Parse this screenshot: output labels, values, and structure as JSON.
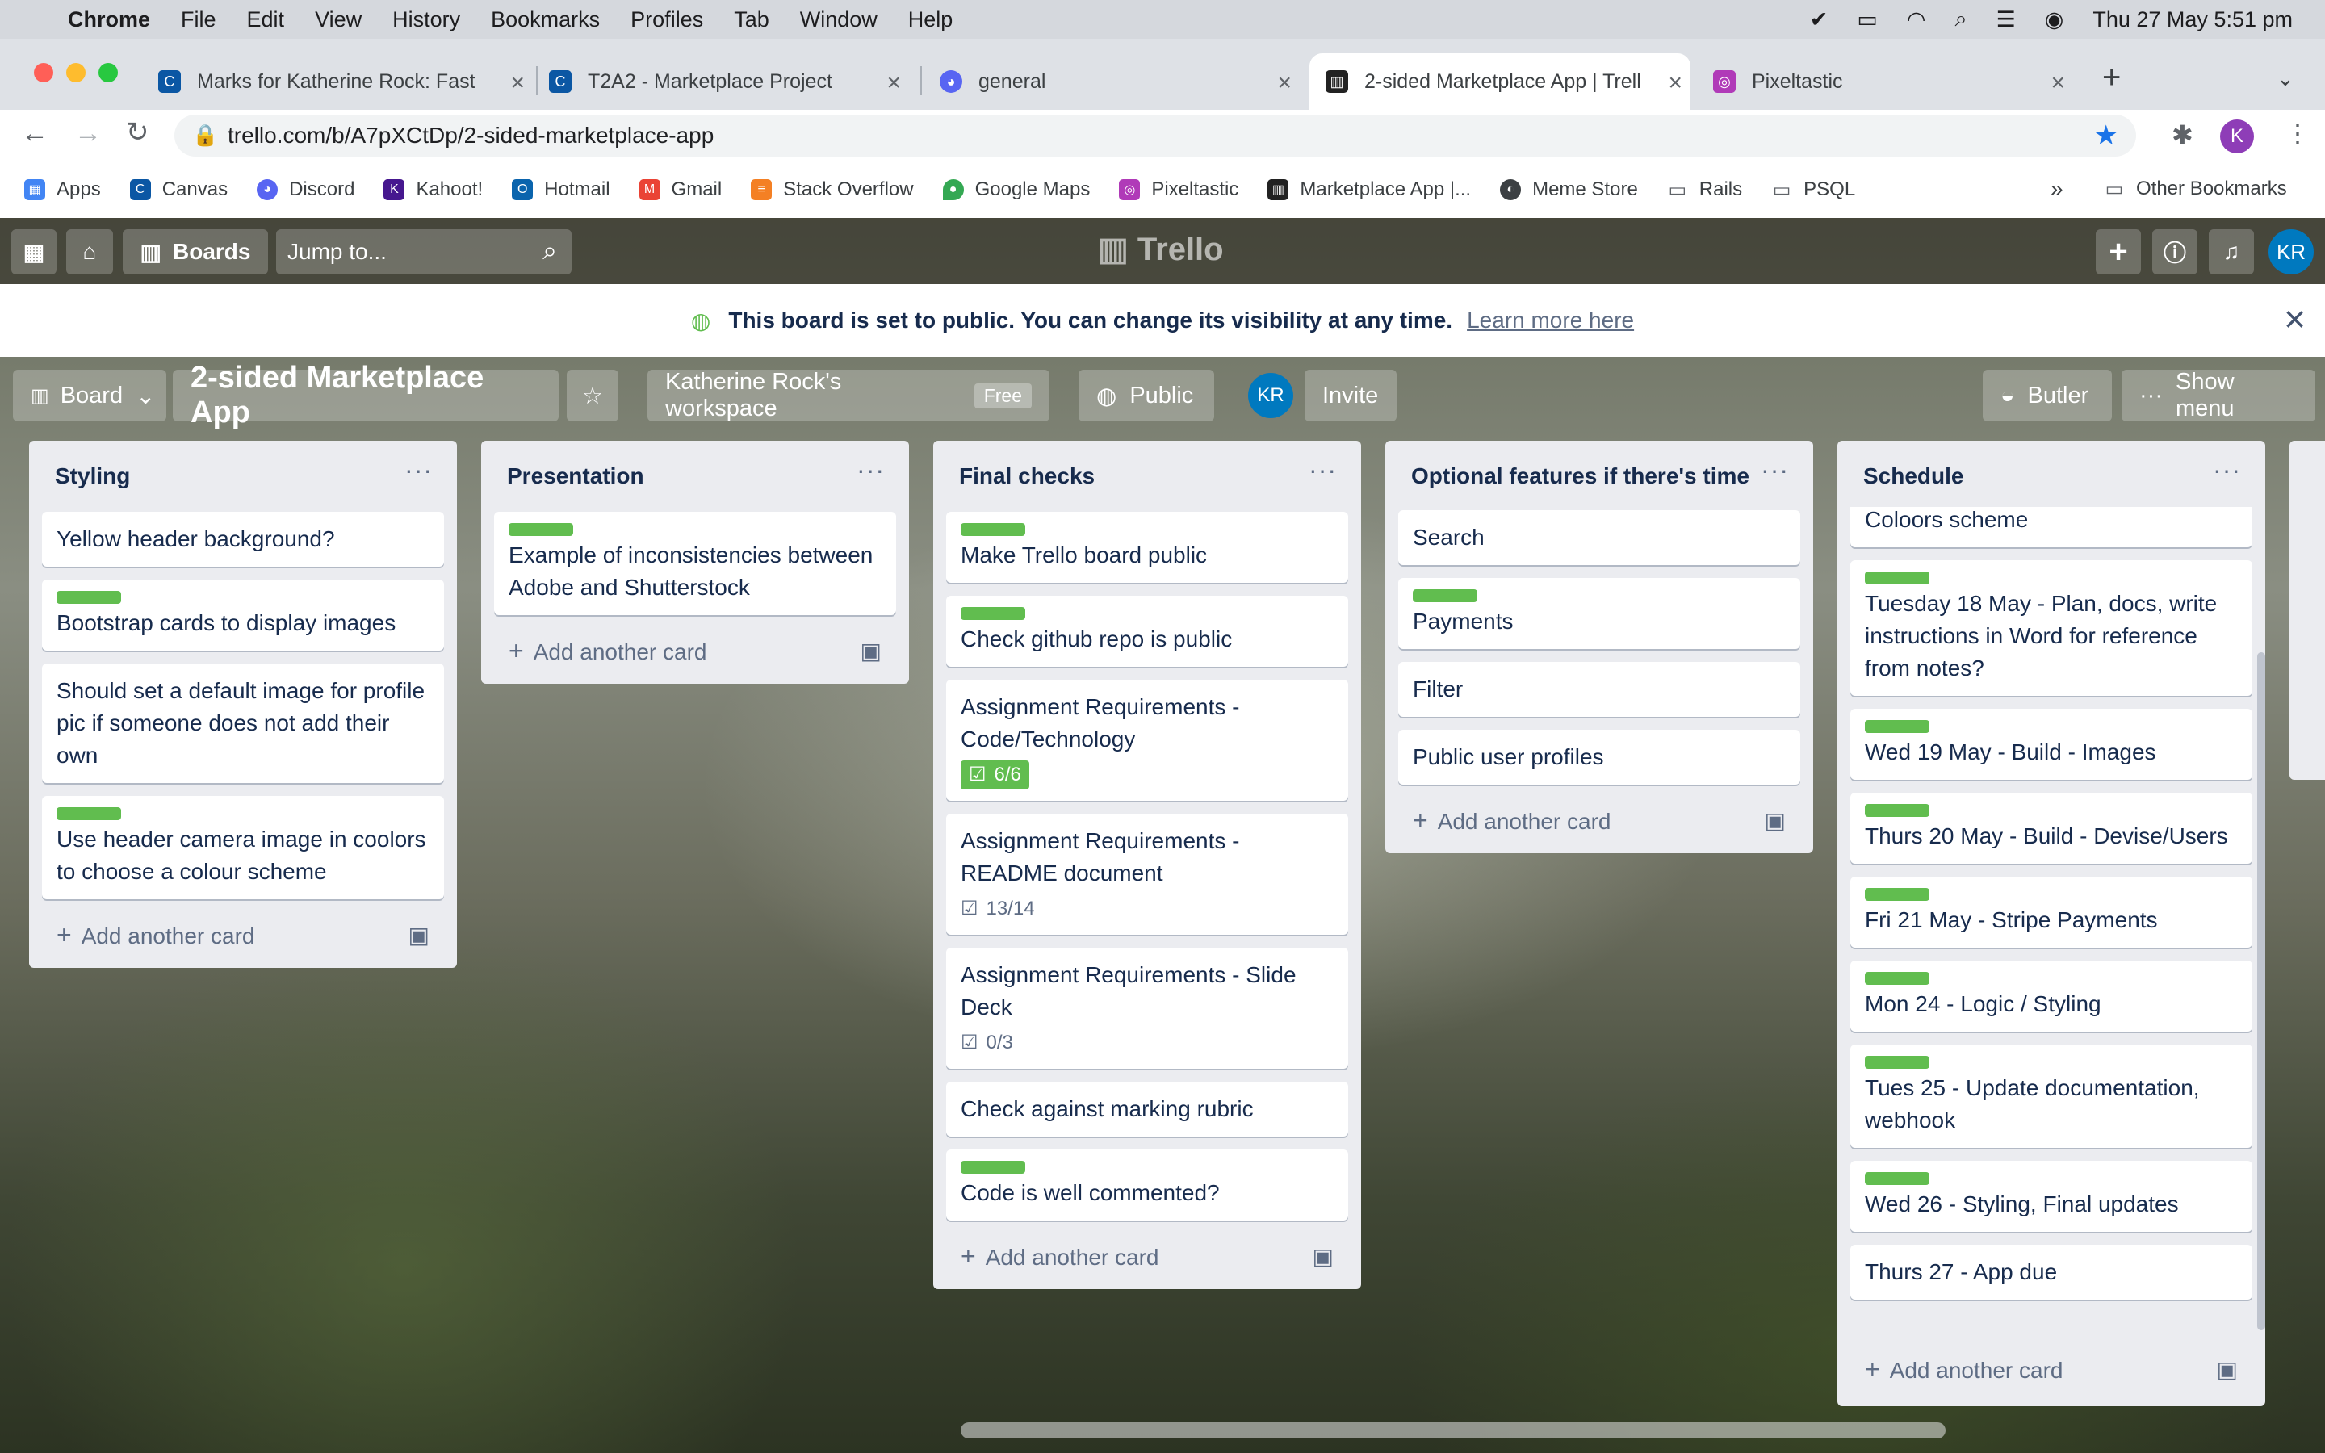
{
  "mac": {
    "app": "Chrome",
    "menus": [
      "File",
      "Edit",
      "View",
      "History",
      "Bookmarks",
      "Profiles",
      "Tab",
      "Window",
      "Help"
    ],
    "datetime": "Thu 27 May  5:51 pm"
  },
  "tabs": [
    {
      "title": "Marks for Katherine Rock: Fast",
      "icon": "canvas-icon"
    },
    {
      "title": "T2A2 - Marketplace Project",
      "icon": "canvas-icon"
    },
    {
      "title": "general",
      "icon": "discord-icon"
    },
    {
      "title": "2-sided Marketplace App | Trell",
      "icon": "trello-icon"
    },
    {
      "title": "Pixeltastic",
      "icon": "pixeltastic-icon"
    }
  ],
  "browser": {
    "url": "trello.com/b/A7pXCtDp/2-sided-marketplace-app",
    "profile_initial": "K"
  },
  "bookmarks": [
    "Apps",
    "Canvas",
    "Discord",
    "Kahoot!",
    "Hotmail",
    "Gmail",
    "Stack Overflow",
    "Google Maps",
    "Pixeltastic",
    "Marketplace App |...",
    "Meme Store",
    "Rails",
    "PSQL"
  ],
  "other_bookmarks": "Other Bookmarks",
  "trello": {
    "boards_label": "Boards",
    "jump_placeholder": "Jump to...",
    "logo": "Trello",
    "avatar": "KR"
  },
  "notice": {
    "text": "This board is set to public. You can change its visibility at any time.",
    "link": "Learn more here"
  },
  "board": {
    "view": "Board",
    "title": "2-sided Marketplace App",
    "workspace": "Katherine Rock's workspace",
    "plan": "Free",
    "visibility": "Public",
    "member": "KR",
    "invite": "Invite",
    "butler": "Butler",
    "show_menu": "Show menu"
  },
  "add_card": "Add another card",
  "lists": [
    {
      "title": "Styling",
      "cards": [
        {
          "text": "Yellow header background?",
          "label": false
        },
        {
          "text": "Bootstrap cards to display images",
          "label": true
        },
        {
          "text": "Should set a default image for profile pic if someone does not add their own",
          "label": false
        },
        {
          "text": "Use header camera image in coolors to choose a colour scheme",
          "label": true
        }
      ]
    },
    {
      "title": "Presentation",
      "cards": [
        {
          "text": "Example of inconsistencies between Adobe and Shutterstock",
          "label": true
        }
      ]
    },
    {
      "title": "Final checks",
      "cards": [
        {
          "text": "Make Trello board public",
          "label": true
        },
        {
          "text": "Check github repo is public",
          "label": true
        },
        {
          "text": "Assignment Requirements - Code/Technology",
          "label": false,
          "checklist": "6/6",
          "complete": true
        },
        {
          "text": "Assignment Requirements - README document",
          "label": false,
          "checklist": "13/14",
          "complete": false
        },
        {
          "text": "Assignment Requirements - Slide Deck",
          "label": false,
          "checklist": "0/3",
          "complete": false
        },
        {
          "text": "Check against marking rubric",
          "label": false
        },
        {
          "text": "Code is well commented?",
          "label": true
        }
      ]
    },
    {
      "title": "Optional features if there's time",
      "cards": [
        {
          "text": "Search",
          "label": false
        },
        {
          "text": "Payments",
          "label": true
        },
        {
          "text": "Filter",
          "label": false
        },
        {
          "text": "Public user profiles",
          "label": false
        }
      ]
    },
    {
      "title": "Schedule",
      "cards": [
        {
          "text": "Coloors scheme",
          "label": false
        },
        {
          "text": "Tuesday 18 May - Plan, docs, write instructions in Word for reference from notes?",
          "label": true
        },
        {
          "text": "Wed 19 May - Build - Images",
          "label": true
        },
        {
          "text": "Thurs 20 May - Build - Devise/Users",
          "label": true
        },
        {
          "text": "Fri 21 May - Stripe Payments",
          "label": true
        },
        {
          "text": "Mon 24 - Logic / Styling",
          "label": true
        },
        {
          "text": "Tues 25 - Update documentation, webhook",
          "label": true
        },
        {
          "text": "Wed 26 - Styling, Final updates",
          "label": true
        },
        {
          "text": "Thurs 27 - App due",
          "label": false
        }
      ]
    }
  ],
  "colors": {
    "label_green": "#61bd4f",
    "trello_blue": "#0079bf"
  }
}
